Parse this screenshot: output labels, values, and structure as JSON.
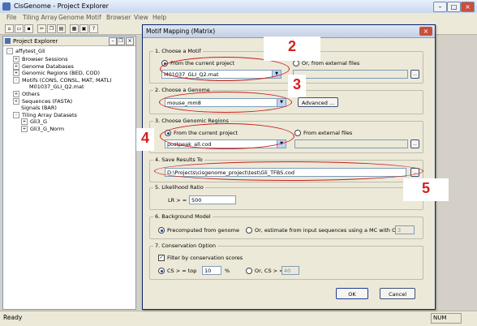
{
  "window": {
    "title": "CisGenome - Project Explorer",
    "controls": {
      "minimize": "–",
      "maximize": "□",
      "close": "×"
    }
  },
  "menu": [
    "File",
    "Tiling Array",
    "Genome",
    "Motif",
    "Browser",
    "View",
    "Help"
  ],
  "toolbar_icons": [
    "new-file-icon",
    "open-folder-icon",
    "save-icon",
    "cut-icon",
    "copy-icon",
    "paste-icon",
    "print-icon",
    "print-preview-icon",
    "help-icon"
  ],
  "explorer": {
    "title": "Project Explorer",
    "root": "affytest_Gli",
    "items": [
      {
        "label": "Browser Sessions",
        "expander": "+",
        "depth": 1
      },
      {
        "label": "Genome Databases",
        "expander": "+",
        "depth": 1
      },
      {
        "label": "Genomic Regions (BED, COD)",
        "expander": "+",
        "depth": 1
      },
      {
        "label": "Motifs (CONS, CONSL, MAT, MATL)",
        "expander": "-",
        "depth": 1
      },
      {
        "label": "M01037_GLI_Q2.mat",
        "expander": "",
        "depth": 2
      },
      {
        "label": "Others",
        "expander": "+",
        "depth": 1
      },
      {
        "label": "Sequences (FASTA)",
        "expander": "+",
        "depth": 1
      },
      {
        "label": "Signals (BAR)",
        "expander": "",
        "depth": 1
      },
      {
        "label": "Tiling Array Datasets",
        "expander": "-",
        "depth": 1
      },
      {
        "label": "Gli3_G",
        "expander": "+",
        "depth": 2
      },
      {
        "label": "Gli3_G_Norm",
        "expander": "+",
        "depth": 2
      }
    ]
  },
  "status": {
    "text": "Ready",
    "num": "NUM"
  },
  "dialog": {
    "title": "Motif Mapping (Matrix)",
    "close": "×",
    "s1": {
      "label": "1. Choose a Motif",
      "opt_current": "From the current project",
      "opt_external": "Or, from external files",
      "value": "M01037_GLI_Q2.mat",
      "browse": "..."
    },
    "s2": {
      "label": "2. Choose a Genome",
      "value": "mouse_mm8",
      "advanced": "Advanced ..."
    },
    "s3": {
      "label": "3. Choose Genomic Regions",
      "opt_current": "From the current project",
      "opt_external": "From external files",
      "value": "postpeak_all.cod",
      "browse": "..."
    },
    "s4": {
      "label": "4. Save Results To",
      "value": "D:\\Projects\\cisgenome_project\\test\\Gli_TFBS.cod",
      "browse": "..."
    },
    "s5": {
      "label": "5. Likelihood Ratio",
      "lr_label": "LR > =",
      "lr_value": "500"
    },
    "s6": {
      "label": "6. Background Model",
      "opt_precomputed": "Precomputed from genome",
      "opt_estimate": "Or, estimate from input sequences using a MC with Order =",
      "order": "3"
    },
    "s7": {
      "label": "7. Conservation Option",
      "filter_label": "Filter by conservation scores",
      "cs_top_label": "CS > = top",
      "cs_top_value": "10",
      "percent": "%",
      "cs_or_label": "Or, CS > =",
      "cs_or_value": "40"
    },
    "ok": "OK",
    "cancel": "Cancel"
  },
  "annotations": [
    "2",
    "3",
    "4",
    "5"
  ],
  "colors": {
    "annotation": "#d42020",
    "dialog_border": "#0a246a"
  }
}
